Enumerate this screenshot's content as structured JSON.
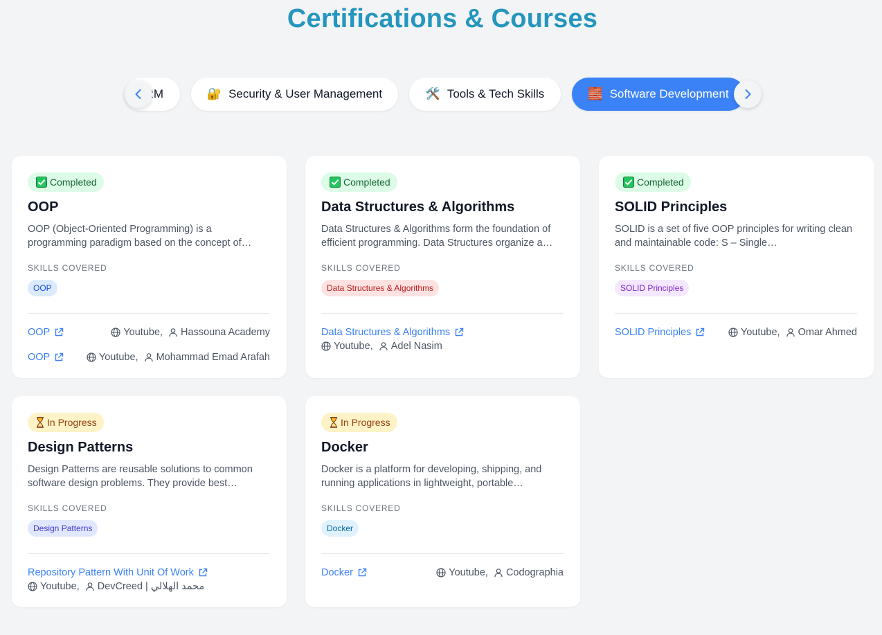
{
  "page": {
    "title": "Certifications & Courses"
  },
  "categories": [
    {
      "label": "RM",
      "emoji": ""
    },
    {
      "label": "Security & User Management",
      "emoji": "🔐"
    },
    {
      "label": "Tools & Tech Skills",
      "emoji": "🛠️"
    },
    {
      "label": "Software Development",
      "emoji": "🧱",
      "active": true
    }
  ],
  "colors": {
    "title": "#2596be",
    "active_pill": "#3b82f6",
    "link": "#3b82f6"
  },
  "skills_label": "SKILLS COVERED",
  "cards": [
    {
      "status": "Completed",
      "title": "OOP",
      "description": "OOP (Object-Oriented Programming) is a programming paradigm based on the concept of…",
      "skills": [
        "OOP"
      ],
      "resources": [
        {
          "name": "OOP",
          "platform": "Youtube,",
          "author": "Hassouna Academy"
        },
        {
          "name": "OOP",
          "platform": "Youtube,",
          "author": "Mohammad Emad Arafah"
        }
      ]
    },
    {
      "status": "Completed",
      "title": "Data Structures & Algorithms",
      "description": "Data Structures & Algorithms form the foundation of efficient programming. Data Structures organize a…",
      "skills": [
        "Data Structures & Algorithms"
      ],
      "resources": [
        {
          "name": "Data Structures & Algorithms",
          "platform": "Youtube,",
          "author": "Adel Nasim"
        }
      ]
    },
    {
      "status": "Completed",
      "title": "SOLID Principles",
      "description": "SOLID is a set of five OOP principles for writing clean and maintainable code: S – Single…",
      "skills": [
        "SOLID Principles"
      ],
      "resources": [
        {
          "name": "SOLID Principles",
          "platform": "Youtube,",
          "author": "Omar Ahmed"
        }
      ]
    },
    {
      "status": "In Progress",
      "title": "Design Patterns",
      "description": "Design Patterns are reusable solutions to common software design problems. They provide best…",
      "skills": [
        "Design Patterns"
      ],
      "resources": [
        {
          "name": "Repository Pattern With Unit Of Work",
          "platform": "Youtube,",
          "author": "DevCreed | محمد الهلالي"
        }
      ]
    },
    {
      "status": "In Progress",
      "title": "Docker",
      "description": "Docker is a platform for developing, shipping, and running applications in lightweight, portable…",
      "skills": [
        "Docker"
      ],
      "resources": [
        {
          "name": "Docker",
          "platform": "Youtube,",
          "author": "Codographia"
        }
      ]
    }
  ]
}
